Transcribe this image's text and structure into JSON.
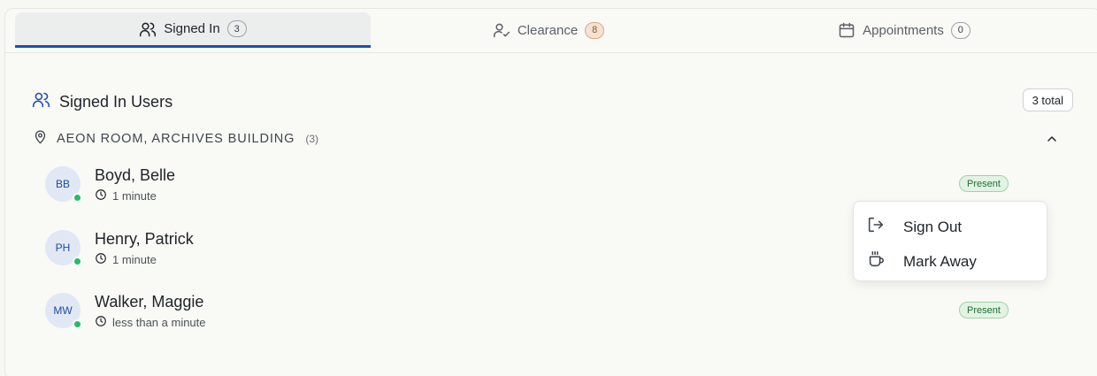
{
  "tabs": [
    {
      "label": "Signed In",
      "count": "3",
      "icon": "users-icon",
      "active": true
    },
    {
      "label": "Clearance",
      "count": "8",
      "icon": "user-check-icon",
      "active": false
    },
    {
      "label": "Appointments",
      "count": "0",
      "icon": "calendar-icon",
      "active": false
    }
  ],
  "section": {
    "title": "Signed In Users",
    "total": "3 total"
  },
  "location": {
    "name": "AEON ROOM, ARCHIVES BUILDING",
    "count": "(3)"
  },
  "users": [
    {
      "initials": "BB",
      "name": "Boyd, Belle",
      "time": "1 minute",
      "status": "Present",
      "online": true
    },
    {
      "initials": "PH",
      "name": "Henry, Patrick",
      "time": "1 minute",
      "status": "",
      "online": true
    },
    {
      "initials": "MW",
      "name": "Walker, Maggie",
      "time": "less than a minute",
      "status": "Present",
      "online": true
    }
  ],
  "menu": {
    "items": [
      {
        "label": "Sign Out",
        "icon": "sign-out-icon"
      },
      {
        "label": "Mark Away",
        "icon": "coffee-cup-icon"
      }
    ]
  },
  "colors": {
    "accent": "#1f4fb0",
    "online": "#1fbf6a",
    "present_bg": "#e2f3e3"
  }
}
